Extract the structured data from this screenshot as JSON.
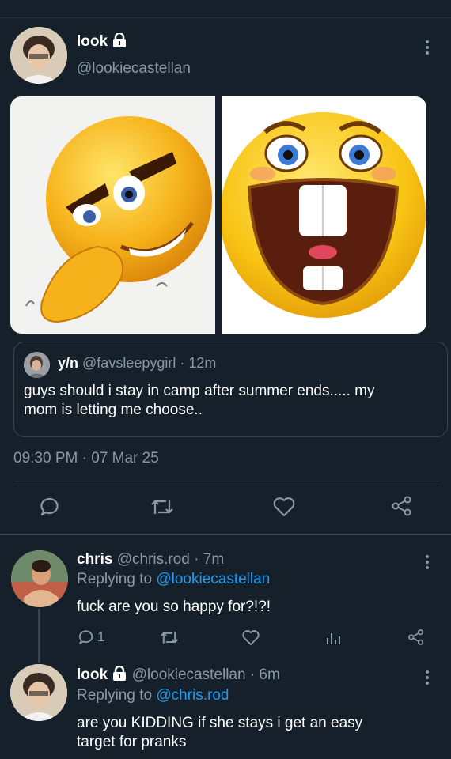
{
  "main_tweet": {
    "display_name": "look",
    "handle": "@lookiecastellan",
    "timestamp": "09:30 PM · 07 Mar 25",
    "images": [
      "devious-laughing-emoji",
      "big-grin-buck-teeth-emoji"
    ]
  },
  "quoted_tweet": {
    "display_name": "y/n",
    "handle": "@favsleepygirl",
    "time": "· 12m",
    "text_line1": "guys should i stay in camp after summer ends..... my",
    "text_line2": "mom is letting me choose.."
  },
  "reply1": {
    "display_name": "chris",
    "handle": "@chris.rod",
    "time": "· 7m",
    "replying_prefix": "Replying to",
    "replying_to": "@lookiecastellan",
    "text": "fuck are you so happy for?!?!",
    "reply_count": "1"
  },
  "reply2": {
    "display_name": "look",
    "handle": "@lookiecastellan",
    "time": "· 6m",
    "replying_prefix": "Replying to",
    "replying_to": "@chris.rod",
    "text_line1": "are you KIDDING if she stays i get an easy",
    "text_line2": "target for pranks"
  },
  "colors": {
    "background": "#15202b",
    "muted": "#8899a6",
    "link": "#1d9bf0",
    "border": "#38444d"
  },
  "icons": [
    "lock-icon",
    "more-icon",
    "reply-icon",
    "retweet-icon",
    "like-icon",
    "share-icon",
    "analytics-icon"
  ]
}
